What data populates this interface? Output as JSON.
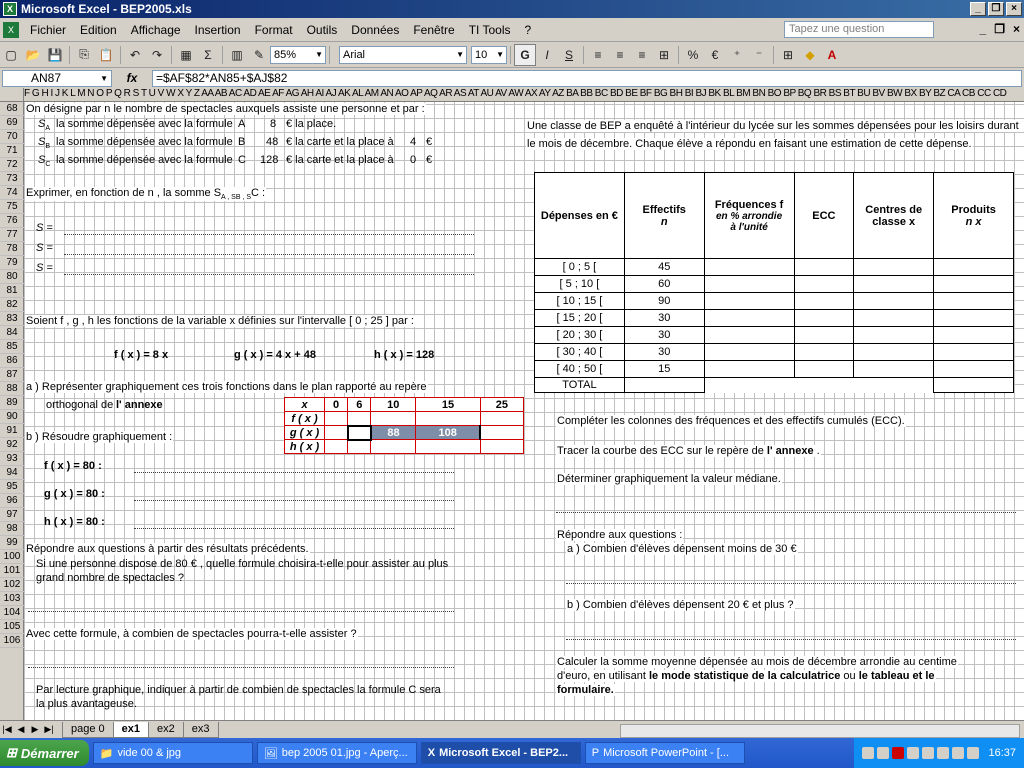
{
  "window": {
    "title": "Microsoft Excel - BEP2005.xls"
  },
  "menu": [
    "Fichier",
    "Edition",
    "Affichage",
    "Insertion",
    "Format",
    "Outils",
    "Données",
    "Fenêtre",
    "TI Tools",
    "?"
  ],
  "ask_placeholder": "Tapez une question",
  "toolbar": {
    "zoom": "85%",
    "font": "Arial",
    "size": "10"
  },
  "formula_bar": {
    "cell": "AN87",
    "formula": "=$AF$82*AN85+$AJ$82"
  },
  "columns": "F G H I J K L M N O P Q R S T U V W X Y Z AA AB AC AD AE AF AG AH AI AJ AK AL AM AN AO AP AQ AR AS AT AU AV AW AX AY AZ BA BB BC BD BE BF BG BH BI BJ BK BL BM BN BO BP BQ BR BS BT BU BV BW BX BY BZ CA CB CC CD",
  "rows": [
    68,
    69,
    70,
    71,
    72,
    73,
    74,
    75,
    76,
    77,
    78,
    79,
    80,
    81,
    82,
    83,
    84,
    85,
    86,
    87,
    88,
    89,
    90,
    91,
    92,
    93,
    94,
    95,
    96,
    97,
    98,
    99,
    100,
    101,
    102,
    103,
    104,
    105,
    106
  ],
  "left": {
    "r68": "On désigne par  n le nombre de  spectacles  auxquels assiste une personne et par :",
    "sa_label": "S",
    "sa_sub": "A",
    "sa_text": "la somme dépensée avec la formule",
    "sa_f": "A",
    "sa_v": "8",
    "sa_unit": "€ la place.",
    "sb_label": "S",
    "sb_sub": "B",
    "sb_text": "la somme dépensée avec la formule",
    "sb_f": "B",
    "sb_v": "48",
    "sb_unit": "€ la carte et la place à",
    "sb_v2": "4",
    "sb_e": "€",
    "sc_label": "S",
    "sc_sub": "C",
    "sc_text": "la somme dépensée avec la formule",
    "sc_f": "C",
    "sc_v": "128",
    "sc_unit": "€ la carte et la place à",
    "sc_v2": "0",
    "sc_e": "€",
    "r73": "Exprimer, en fonction de  n , la somme   S",
    "r73b": "A ,  S",
    "r73c": "B ,  S",
    "r73d": "C  :",
    "sa_eq": "S  =",
    "sb_eq": "S  =",
    "sc_eq": "S  =",
    "r80": "Soient   f ,  g ,  h les fonctions de la variable x définies sur l'intervalle  [   0   ;   25  ]  par :",
    "f_def": "f ( x )  =  8  x",
    "g_def": "g ( x )  =  4  x + 48",
    "h_def": "h ( x )  =  128",
    "r84": "a )   Représenter graphiquement ces trois fonctions dans le plan rapporté au repère",
    "r85a": "orthogonal de",
    "r85b": "l' annexe",
    "r87": "b )   Résoudre graphiquement :",
    "r89": "f ( x )  = 80     :",
    "r91": "g ( x )  = 80     :",
    "r93": "h ( x )  = 80     :",
    "r95": "Répondre aux questions à partir des résultats précédents.",
    "r96": "Si une personne dispose de   80  € , quelle formule choisira-t-elle pour assister au plus",
    "r97": "grand nombre de   spectacles   ?",
    "r101": "Avec cette formule, à combien de   spectacles   pourra-t-elle assister ?",
    "r105": "Par lecture graphique, indiquer à partir de combien de spectacles  la formule C sera",
    "r106": "la plus avantageuse."
  },
  "small_table": {
    "header": [
      "x",
      "0",
      "6",
      "10",
      "15",
      "25"
    ],
    "rows": [
      [
        "f ( x )",
        "",
        "",
        "",
        "",
        ""
      ],
      [
        "g ( x )",
        "",
        "",
        "88",
        "108",
        ""
      ],
      [
        "h ( x )",
        "",
        "",
        "",
        "",
        ""
      ]
    ]
  },
  "right": {
    "intro1": "Une classe de BEP a enquêté à l'intérieur du lycée sur les sommes dépensées pour les loisirs durant",
    "intro2": "le mois de décembre. Chaque élève a répondu en faisant une estimation de cette dépense.",
    "table_headers": {
      "depenses": "Dépenses en €",
      "effectifs": "Effectifs",
      "effectifs_sym": "n",
      "frequences": "Fréquences f",
      "freq_note1": "en  % arrondie",
      "freq_note2": "à  l'unité",
      "ecc": "ECC",
      "centres": "Centres de",
      "centres2": "classe x",
      "produits": "Produits",
      "produits2": "n x"
    },
    "classes": [
      {
        "interval": "[   0   ;   5   [",
        "n": "45"
      },
      {
        "interval": "[   5   ;   10  [",
        "n": "60"
      },
      {
        "interval": "[  10  ;   15  [",
        "n": "90"
      },
      {
        "interval": "[  15  ;   20  [",
        "n": "30"
      },
      {
        "interval": "[  20  ;   30  [",
        "n": "30"
      },
      {
        "interval": "[  30  ;   40  [",
        "n": "30"
      },
      {
        "interval": "[  40  ;   50  [",
        "n": "15"
      }
    ],
    "total": "TOTAL",
    "q1": "Compléter les colonnes des fréquences et des effectifs cumulés (ECC).",
    "q2a": "Tracer la courbe des ECC sur le repère de",
    "q2b": "l' annexe",
    "q2c": ".",
    "q3": "Déterminer graphiquement la valeur médiane.",
    "q4": "Répondre aux questions :",
    "q4a": "a )      Combien d'élèves dépensent moins de    30  €",
    "q4b": "b )      Combien d'élèves dépensent  20   € et plus ?",
    "q5a": "Calculer la somme moyenne dépensée au mois de décembre arrondie au centime",
    "q5b": "d'euro, en utilisant",
    "q5c": "le mode statistique de la calculatrice",
    "q5d": "ou",
    "q5e": "le tableau et le",
    "q5f": "formulaire."
  },
  "tabs": [
    "page 0",
    "ex1",
    "ex2",
    "ex3"
  ],
  "taskbar": {
    "start": "Démarrer",
    "items": [
      "vide 00 & jpg",
      "bep 2005 01.jpg - Aperç...",
      "Microsoft Excel - BEP2...",
      "Microsoft PowerPoint - [..."
    ],
    "clock": "16:37"
  }
}
